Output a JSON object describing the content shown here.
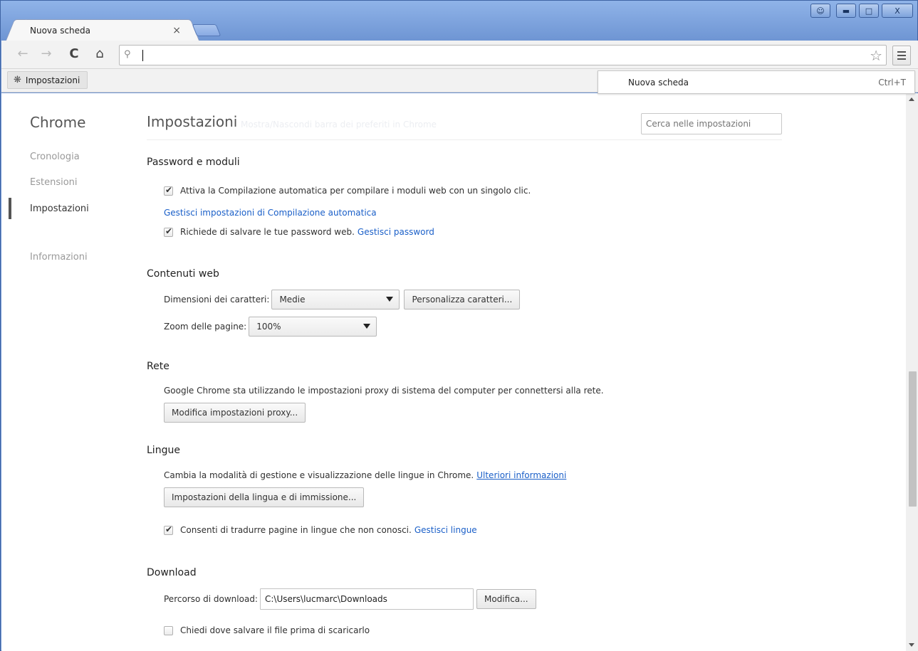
{
  "tab": {
    "title": "Nuova scheda",
    "close_glyph": "×"
  },
  "omnibox": {
    "value": "",
    "placeholder": ""
  },
  "bookmarks": {
    "item_label": "Impostazioni"
  },
  "menu_popup": {
    "label": "Nuova scheda",
    "shortcut": "Ctrl+T"
  },
  "sidebar": {
    "title": "Chrome",
    "items": [
      {
        "label": "Cronologia",
        "active": false
      },
      {
        "label": "Estensioni",
        "active": false
      },
      {
        "label": "Impostazioni",
        "active": true
      },
      {
        "label": "Informazioni",
        "active": false
      }
    ]
  },
  "main": {
    "title": "Impostazioni",
    "ghost_text": "Mostra/Nascondi barra dei preferiti in Chrome",
    "search_placeholder": "Cerca nelle impostazioni",
    "passwords": {
      "title": "Password e moduli",
      "autofill_label": "Attiva la Compilazione automatica per compilare i moduli web con un singolo clic.",
      "autofill_checked": true,
      "manage_autofill_link": "Gestisci impostazioni di Compilazione automatica",
      "save_passwords_label": "Richiede di salvare le tue password web.",
      "save_passwords_checked": true,
      "manage_passwords_link": "Gestisci password"
    },
    "web_content": {
      "title": "Contenuti web",
      "font_size_label": "Dimensioni dei caratteri:",
      "font_size_value": "Medie",
      "customize_fonts_button": "Personalizza caratteri...",
      "zoom_label": "Zoom delle pagine:",
      "zoom_value": "100%"
    },
    "network": {
      "title": "Rete",
      "description": "Google Chrome sta utilizzando le impostazioni proxy di sistema del computer per connettersi alla rete.",
      "proxy_button": "Modifica impostazioni proxy..."
    },
    "languages": {
      "title": "Lingue",
      "description": "Cambia la modalità di gestione e visualizzazione delle lingue in Chrome.",
      "more_info_link": "Ulteriori informazioni",
      "language_button": "Impostazioni della lingua e di immissione...",
      "translate_label": "Consenti di tradurre pagine in lingue che non conosci.",
      "translate_checked": true,
      "manage_languages_link": "Gestisci lingue"
    },
    "downloads": {
      "title": "Download",
      "path_label": "Percorso di download:",
      "path_value": "C:\\Users\\lucmarc\\Downloads",
      "change_button": "Modifica...",
      "ask_label": "Chiedi dove salvare il file prima di scaricarlo",
      "ask_checked": false
    }
  },
  "icons": {
    "back": "back-arrow-icon",
    "forward": "forward-arrow-icon",
    "reload": "reload-icon",
    "home": "home-icon",
    "search": "search-icon",
    "star": "star-icon",
    "menu": "hamburger-menu-icon",
    "gear": "gear-icon"
  }
}
